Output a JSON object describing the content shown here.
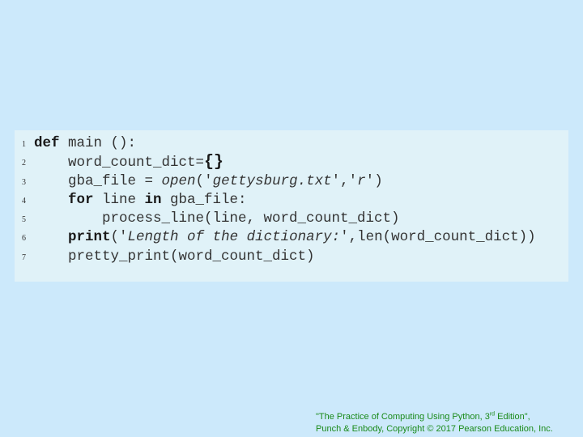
{
  "code": {
    "lines": [
      {
        "num": "1",
        "kw_def": "def",
        "rest": " main ():"
      },
      {
        "num": "2",
        "text": "word_count_dict=",
        "brace": "{}"
      },
      {
        "num": "3",
        "pre": "gba_file = ",
        "open_fn": "open",
        "paren_open": "(",
        "q1": "'",
        "arg1": "gettysburg.txt",
        "q2": "'",
        "comma": ",",
        "q3": "'",
        "arg2": "r",
        "q4": "'",
        "paren_close": ")"
      },
      {
        "num": "4",
        "kw_for": "for",
        "mid": " line ",
        "kw_in": "in",
        "rest": " gba_file:"
      },
      {
        "num": "5",
        "text": "process_line(line, word_count_dict)"
      },
      {
        "num": "6",
        "kw_print": "print",
        "paren_open": "(",
        "q1": "'",
        "str": "Length of the dictionary:",
        "q2": "'",
        "rest": ",len(word_count_dict))"
      },
      {
        "num": "7",
        "text": "pretty_print(word_count_dict)"
      }
    ]
  },
  "footer": {
    "line1_pre": "\"The Practice of Computing Using Python, 3",
    "line1_sup": "rd",
    "line1_post": " Edition\",",
    "line2": "Punch & Enbody, Copyright © 2017 Pearson Education, Inc."
  }
}
